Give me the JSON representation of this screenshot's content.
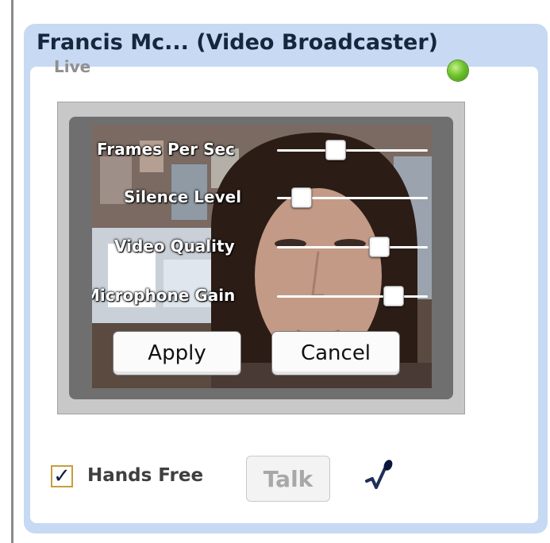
{
  "header": {
    "title": "Francis Mc... (Video Broadcaster)"
  },
  "status": {
    "label": "Live",
    "indicator_color": "#6fc22c"
  },
  "controls": {
    "sliders": [
      {
        "label": "Frames Per Sec",
        "value": 0.37
      },
      {
        "label": "Silence Level",
        "value": 0.11
      },
      {
        "label": "Video Quality",
        "value": 0.71
      },
      {
        "label": "Microphone Gain",
        "value": 0.82
      }
    ],
    "apply_label": "Apply",
    "cancel_label": "Cancel"
  },
  "footer": {
    "hands_free_label": "Hands Free",
    "hands_free_checked": true,
    "talk_label": "Talk",
    "mic_icon": "microphone-icon"
  }
}
